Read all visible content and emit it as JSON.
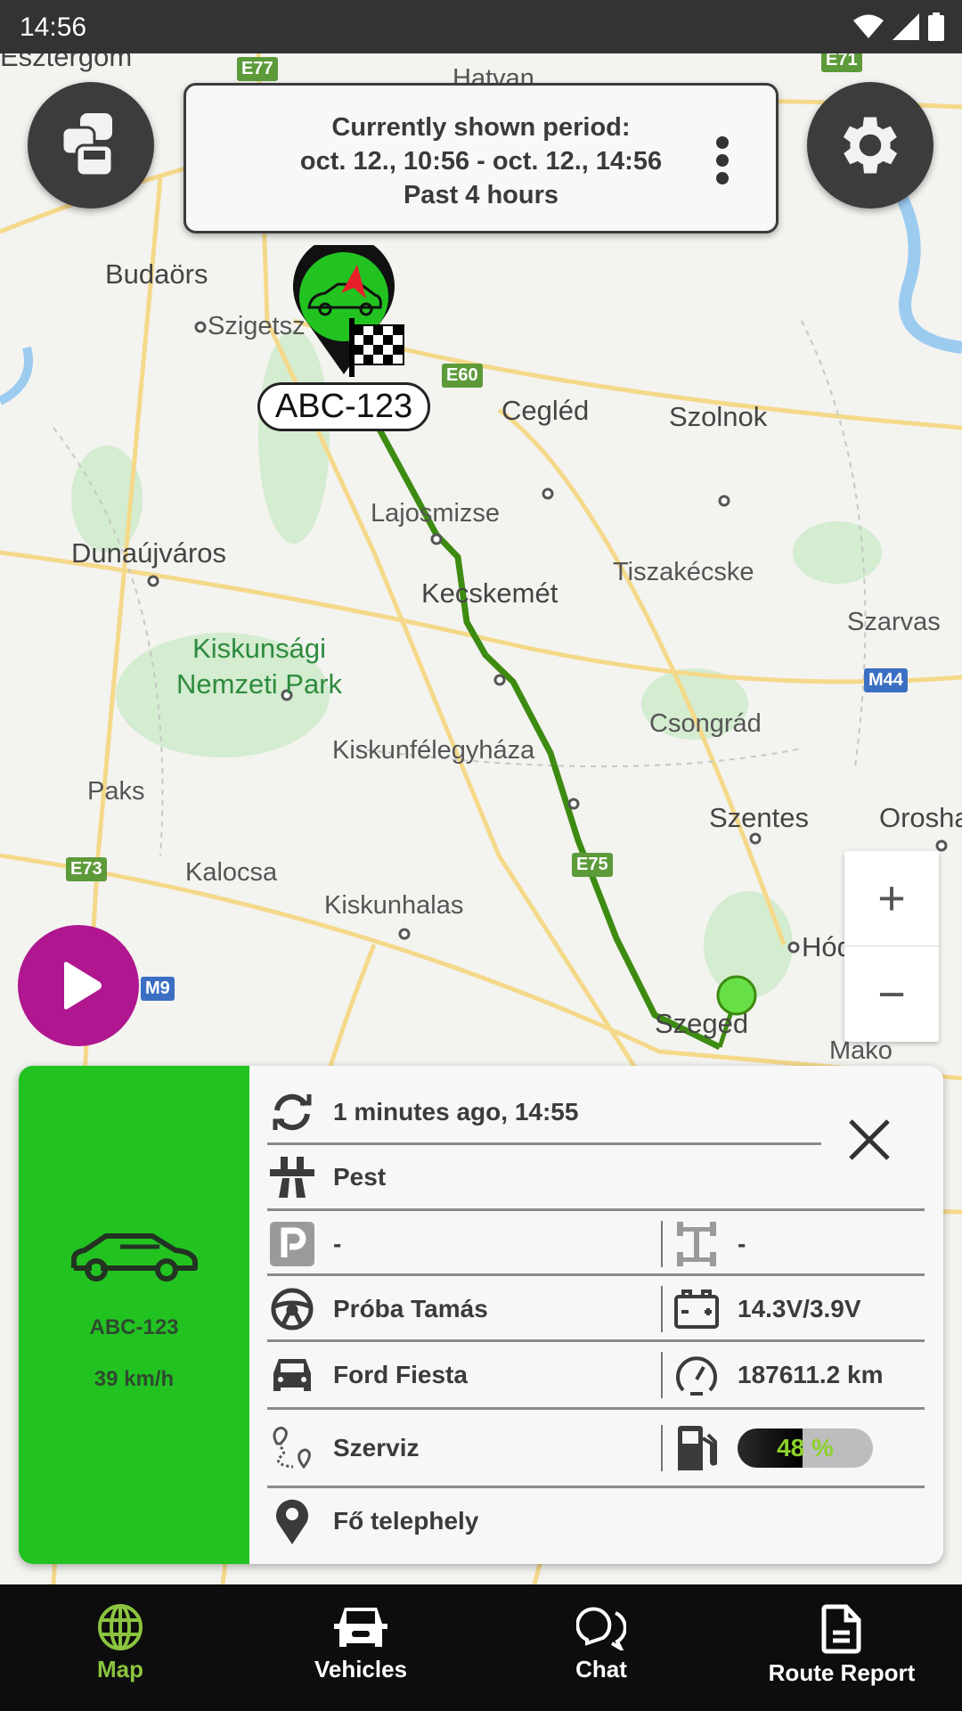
{
  "status_bar": {
    "time": "14:56"
  },
  "map": {
    "labels": [
      "Esztergom",
      "Hatvan",
      "Budaörs",
      "Szigetsz",
      "Cegléd",
      "Szolnok",
      "Lajosmizse",
      "Dunaújváros",
      "Kecskemét",
      "Tiszakécske",
      "Szarvas",
      "Kiskunsági",
      "Nemzeti Park",
      "Csongrád",
      "Kiskunfélegyháza",
      "Paks",
      "Szentes",
      "Orosha",
      "Kalocsa",
      "Kiskunhalas",
      "Szeged",
      "Hód",
      "Mako"
    ],
    "shields": [
      "E77",
      "E71",
      "E60",
      "E75",
      "E73",
      "M44",
      "M9"
    ],
    "route_color": "#3d8b11",
    "vehicle_marker": {
      "plate": "ABC-123",
      "color": "#22c321"
    }
  },
  "period": {
    "line1": "Currently shown period:",
    "line2": "oct. 12., 10:56 - oct. 12., 14:56",
    "line3": "Past 4 hours"
  },
  "zoom": {
    "in": "+",
    "out": "−"
  },
  "card": {
    "plate": "ABC-123",
    "speed": "39 km/h",
    "side_color": "#22c321",
    "updated": "1 minutes ago, 14:55",
    "region": "Pest",
    "parking": "-",
    "axle": "-",
    "driver": "Próba Tamás",
    "battery": "14.3V/3.9V",
    "model": "Ford Fiesta",
    "odometer": "187611.2 km",
    "route": "Szerviz",
    "fuel_percent": 48,
    "fuel_label": "48 %",
    "location": "Fő telephely"
  },
  "nav": {
    "active_color": "#8bc43f",
    "tabs": [
      {
        "label": "Map"
      },
      {
        "label": "Vehicles"
      },
      {
        "label": "Chat"
      },
      {
        "label": "Route Report"
      }
    ]
  }
}
